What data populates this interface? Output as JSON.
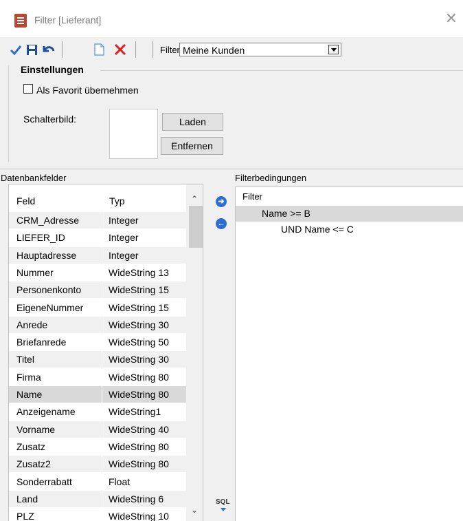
{
  "window": {
    "title": "Filter  [Lieferant]",
    "close": "✕"
  },
  "toolbar": {
    "filter_label": "Filter",
    "filter_value": "Meine Kunden",
    "icons": [
      "checkmark-icon",
      "save-icon",
      "undo-icon",
      "new-document-icon",
      "delete-icon"
    ]
  },
  "settings": {
    "title": "Einstellungen",
    "favorite_label": "Als Favorit übernehmen",
    "favorite_checked": false,
    "icon_label": "Schalterbild:",
    "load_button": "Laden",
    "remove_button": "Entfernen"
  },
  "fields_panel": {
    "label": "Datenbankfelder",
    "columns": [
      "Feld",
      "Typ"
    ],
    "rows": [
      {
        "feld": "CRM_Adresse",
        "typ": "Integer"
      },
      {
        "feld": "LIEFER_ID",
        "typ": "Integer"
      },
      {
        "feld": "Hauptadresse",
        "typ": "Integer"
      },
      {
        "feld": "Nummer",
        "typ": "WideString 13"
      },
      {
        "feld": "Personenkonto",
        "typ": "WideString 15"
      },
      {
        "feld": "EigeneNummer",
        "typ": "WideString 15"
      },
      {
        "feld": "Anrede",
        "typ": "WideString 30"
      },
      {
        "feld": "Briefanrede",
        "typ": "WideString 50"
      },
      {
        "feld": "Titel",
        "typ": "WideString 30"
      },
      {
        "feld": "Firma",
        "typ": "WideString 80"
      },
      {
        "feld": "Name",
        "typ": "WideString 80"
      },
      {
        "feld": "Anzeigename",
        "typ": "WideString1"
      },
      {
        "feld": "Vorname",
        "typ": "WideString 40"
      },
      {
        "feld": "Zusatz",
        "typ": "WideString 80"
      },
      {
        "feld": "Zusatz2",
        "typ": "WideString 80"
      },
      {
        "feld": "Sonderrabatt",
        "typ": "Float"
      },
      {
        "feld": "Land",
        "typ": "WideString  6"
      },
      {
        "feld": "PLZ",
        "typ": "WideString 10"
      }
    ],
    "selected_row": 10
  },
  "move_buttons": {
    "add": "➔",
    "remove": "←"
  },
  "sql_label": "SQL",
  "conditions_panel": {
    "label": "Filterbedingungen",
    "root": "Filter",
    "nodes": [
      {
        "text": "Name >= B",
        "level": 1,
        "selected": true
      },
      {
        "text": "UND Name <= C",
        "level": 2,
        "selected": false
      }
    ]
  },
  "colors": {
    "accent": "#2c6fd0",
    "delete": "#e02020",
    "save": "#1c4fa0"
  }
}
